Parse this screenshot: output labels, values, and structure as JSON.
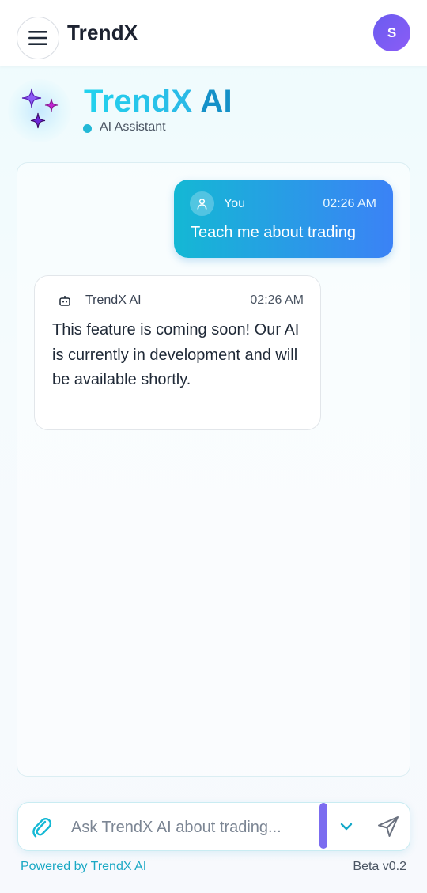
{
  "header": {
    "brand": "TrendX",
    "avatar_initial": "S"
  },
  "hero": {
    "title_part1": "TrendX",
    "title_part2": "AI",
    "status": "AI Assistant",
    "sparkle_colors": [
      "#8b5cf6",
      "#c026d3",
      "#6d28d9"
    ]
  },
  "messages": [
    {
      "sender": "You",
      "time": "02:26 AM",
      "text": "Teach me about trading",
      "role": "user"
    },
    {
      "sender": "TrendX AI",
      "time": "02:26 AM",
      "text": "This feature is coming soon! Our AI is currently in development and will be available shortly.",
      "role": "assistant"
    }
  ],
  "composer": {
    "placeholder": "Ask TrendX AI about trading..."
  },
  "footer": {
    "powered_by": "Powered by TrendX AI",
    "version": "Beta v0.2"
  },
  "colors": {
    "accent_cyan": "#14b8d4",
    "accent_blue": "#3b82f6",
    "accent_purple": "#7b6cf0"
  }
}
